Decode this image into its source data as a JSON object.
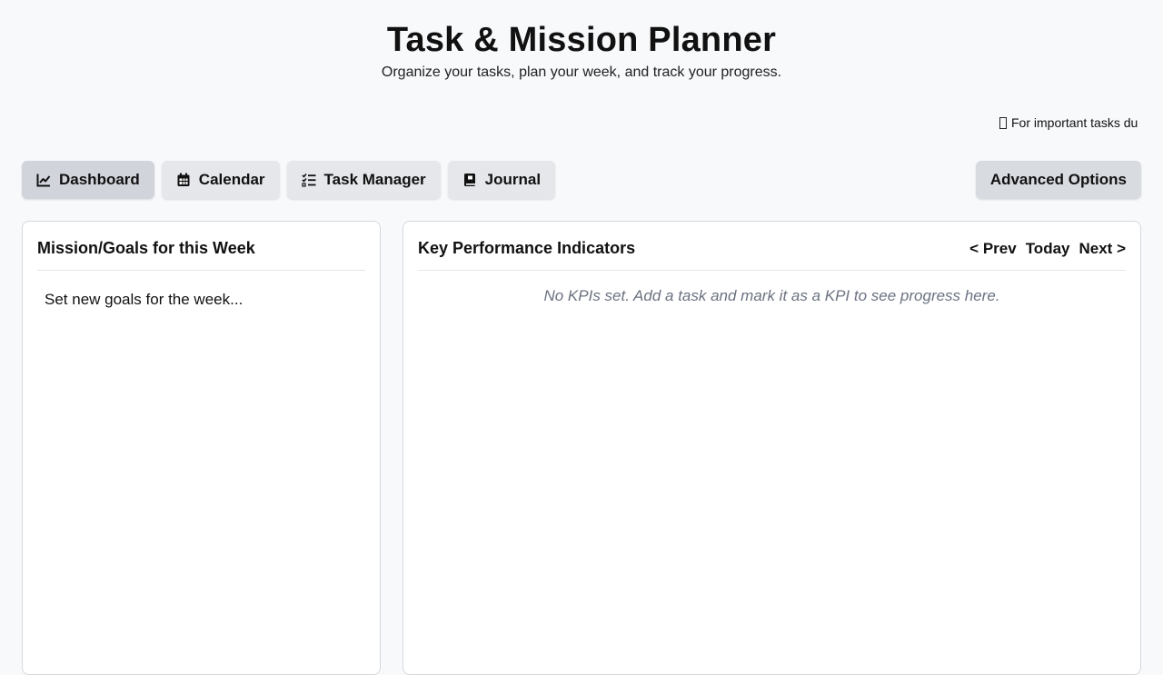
{
  "header": {
    "title": "Task & Mission Planner",
    "subtitle": "Organize your tasks, plan your week, and track your progress."
  },
  "ticker": {
    "icon": "missing-glyph-icon",
    "text": "For important tasks du"
  },
  "nav": {
    "tabs": [
      {
        "label": "Dashboard",
        "icon": "chart-line-icon",
        "active": true
      },
      {
        "label": "Calendar",
        "icon": "calendar-icon",
        "active": false
      },
      {
        "label": "Task Manager",
        "icon": "checklist-icon",
        "active": false
      },
      {
        "label": "Journal",
        "icon": "book-icon",
        "active": false
      }
    ],
    "advanced_label": "Advanced Options"
  },
  "goals": {
    "title": "Mission/Goals for this Week",
    "text": "Set new goals for the week..."
  },
  "kpi": {
    "title": "Key Performance Indicators",
    "prev_label": "< Prev",
    "today_label": "Today",
    "next_label": "Next >",
    "empty_message": "No KPIs set. Add a task and mark it as a KPI to see progress here."
  },
  "colors": {
    "background": "#f8f9fb",
    "button": "#e5e7eb",
    "button_active": "#d1d5db",
    "muted_text": "#6b7280"
  }
}
